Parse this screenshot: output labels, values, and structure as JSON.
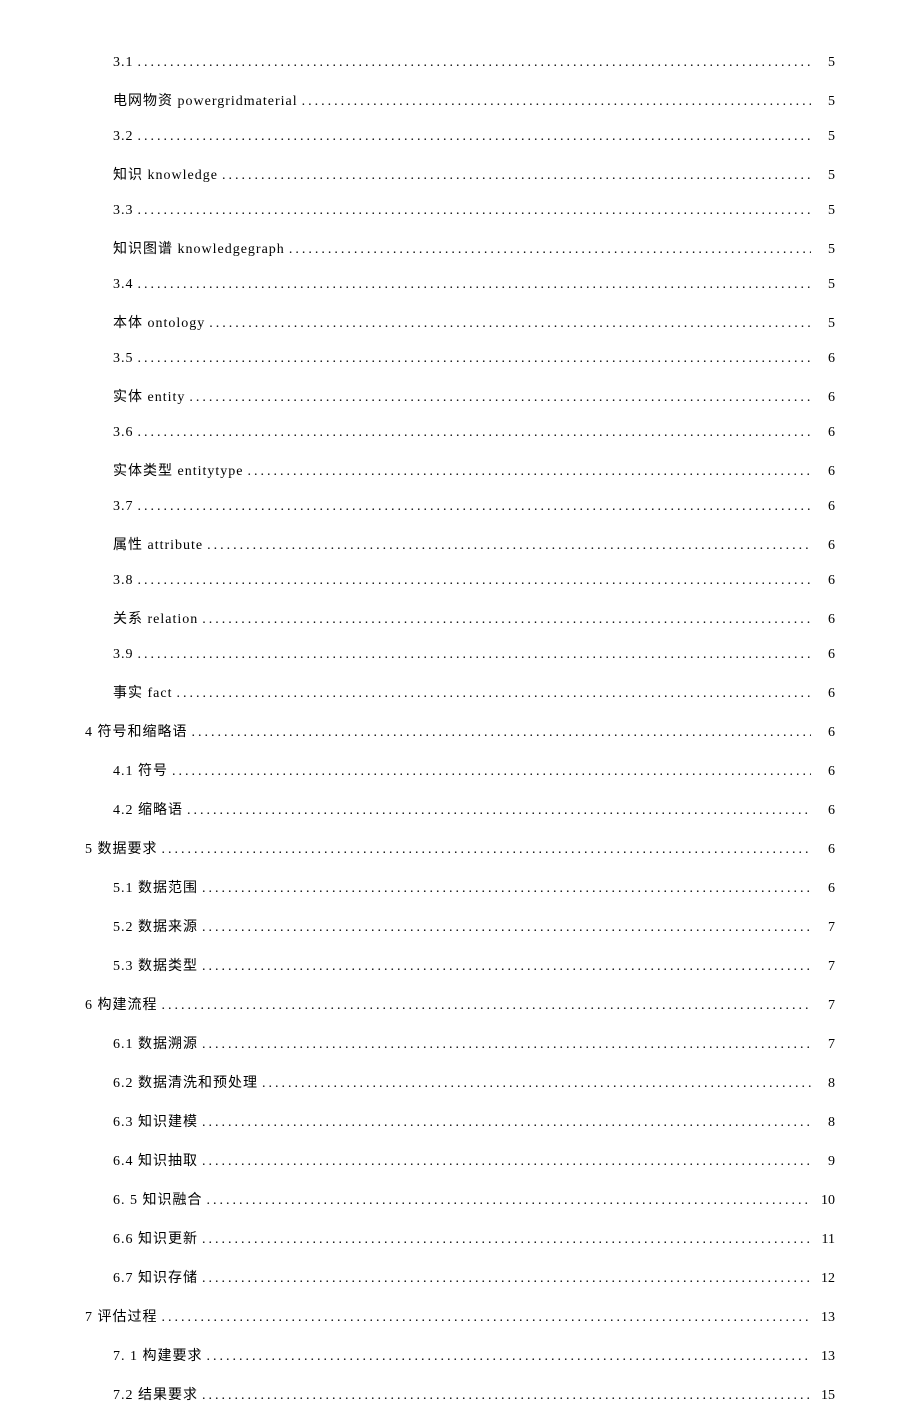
{
  "toc": [
    {
      "level": 2,
      "label": "3.1",
      "page": "5"
    },
    {
      "level": 2,
      "label": "电网物资 powergridmaterial",
      "page": "5"
    },
    {
      "level": 2,
      "label": "3.2 ",
      "page": "5"
    },
    {
      "level": 2,
      "label": "知识 knowledge",
      "page": "5"
    },
    {
      "level": 2,
      "label": "3.3 ",
      "page": "5"
    },
    {
      "level": 2,
      "label": "知识图谱 knowledgegraph",
      "page": "5"
    },
    {
      "level": 2,
      "label": "3.4 ",
      "page": "5"
    },
    {
      "level": 2,
      "label": "本体 ontology",
      "page": "5"
    },
    {
      "level": 2,
      "label": "3.5 ",
      "page": "6"
    },
    {
      "level": 2,
      "label": "实体 entity",
      "page": "6"
    },
    {
      "level": 2,
      "label": "3.6 ",
      "page": "6"
    },
    {
      "level": 2,
      "label": "实体类型 entitytype",
      "page": "6"
    },
    {
      "level": 2,
      "label": "3.7 ",
      "page": "6"
    },
    {
      "level": 2,
      "label": "属性 attribute",
      "page": "6"
    },
    {
      "level": 2,
      "label": "3.8 ",
      "page": "6"
    },
    {
      "level": 2,
      "label": "关系 relation",
      "page": "6"
    },
    {
      "level": 2,
      "label": "3.9 ",
      "page": "6"
    },
    {
      "level": 2,
      "label": "事实 fact",
      "page": "6"
    },
    {
      "level": 1,
      "label": "4 符号和缩略语",
      "page": "6"
    },
    {
      "level": 2,
      "label": "4.1 符号",
      "page": "6"
    },
    {
      "level": 2,
      "label": "4.2 缩略语",
      "page": "6"
    },
    {
      "level": 1,
      "label": "5 数据要求",
      "page": "6"
    },
    {
      "level": 2,
      "label": "5.1  数据范围",
      "page": "6"
    },
    {
      "level": 2,
      "label": "5.2  数据来源",
      "page": "7"
    },
    {
      "level": 2,
      "label": "5.3  数据类型",
      "page": "7"
    },
    {
      "level": 1,
      "label": "6 构建流程",
      "page": "7"
    },
    {
      "level": 2,
      "label": "6.1 数据溯源",
      "page": "7"
    },
    {
      "level": 2,
      "label": "6.2 数据清洗和预处理",
      "page": "8"
    },
    {
      "level": 2,
      "label": "6.3 知识建模",
      "page": "8"
    },
    {
      "level": 2,
      "label": "6.4 知识抽取",
      "page": "9"
    },
    {
      "level": 2,
      "label": "6. 5 知识融合",
      "page": "10"
    },
    {
      "level": 2,
      "label": "6.6  知识更新",
      "page": "11"
    },
    {
      "level": 2,
      "label": "6.7  知识存储",
      "page": "12"
    },
    {
      "level": 1,
      "label": "7 评估过程",
      "page": "13"
    },
    {
      "level": 2,
      "label": "7. 1 构建要求",
      "page": "13"
    },
    {
      "level": 2,
      "label": "7.2 结果要求",
      "page": "15"
    }
  ]
}
